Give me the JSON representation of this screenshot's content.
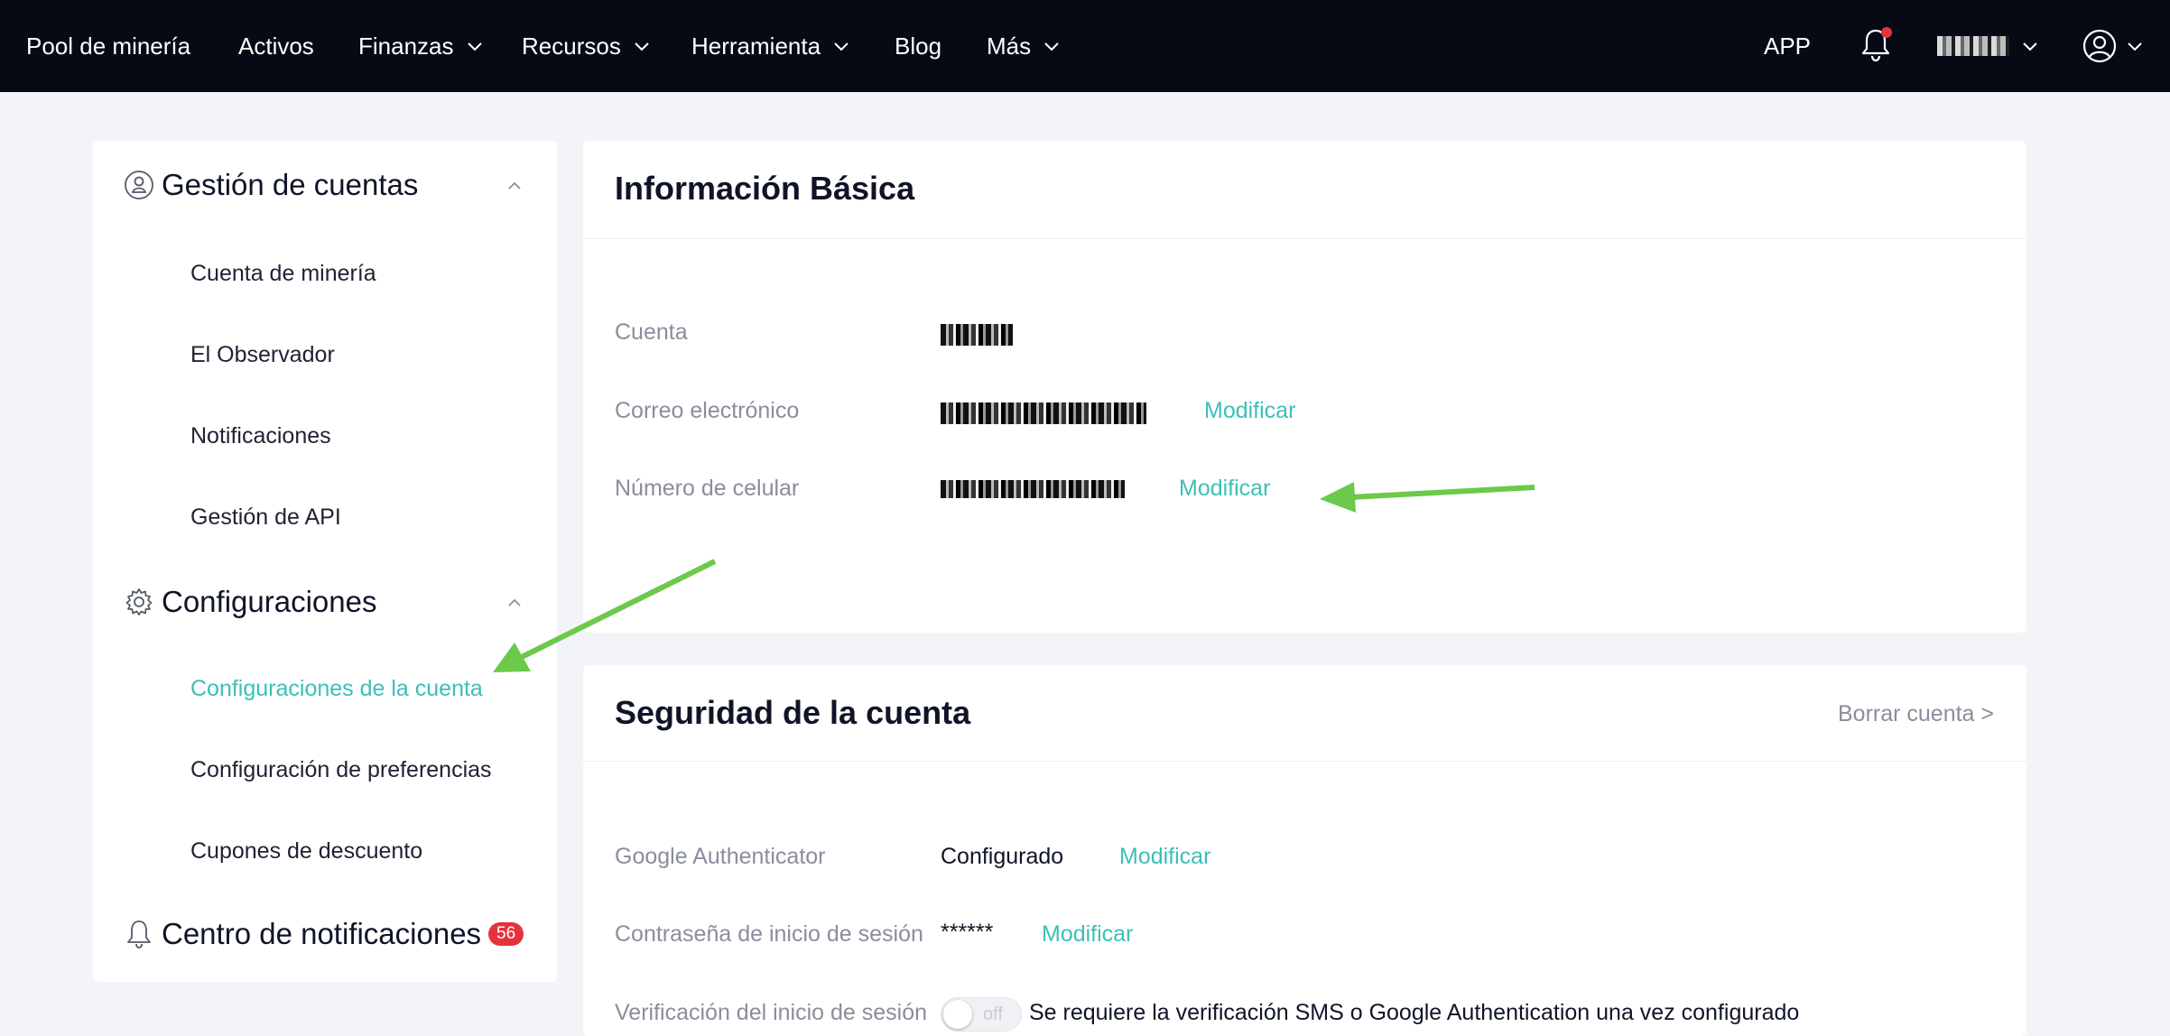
{
  "topnav": {
    "brand": "Pool de minería",
    "items": [
      {
        "label": "Activos"
      },
      {
        "label": "Finanzas"
      },
      {
        "label": "Recursos"
      },
      {
        "label": "Herramienta"
      },
      {
        "label": "Blog"
      },
      {
        "label": "Más"
      }
    ],
    "app_label": "APP",
    "notification_dot_color": "#e5323d"
  },
  "sidebar": {
    "account_group": {
      "title": "Gestión de cuentas",
      "items": [
        "Cuenta de minería",
        "El Observador",
        "Notificaciones",
        "Gestión de API"
      ]
    },
    "settings_group": {
      "title": "Configuraciones",
      "items": [
        "Configuraciones de la cuenta",
        "Configuración de preferencias",
        "Cupones de descuento"
      ],
      "active_index": 0
    },
    "notification_center": {
      "title": "Centro de notificaciones",
      "badge": "56"
    }
  },
  "basic_info": {
    "title": "Información Básica",
    "rows": [
      {
        "label": "Cuenta"
      },
      {
        "label": "Correo electrónico",
        "action": "Modificar"
      },
      {
        "label": "Número de celular",
        "action": "Modificar"
      }
    ]
  },
  "security": {
    "title": "Seguridad de la cuenta",
    "delete_link": "Borrar cuenta >",
    "rows": [
      {
        "label": "Google Authenticator",
        "value": "Configurado",
        "action": "Modificar"
      },
      {
        "label": "Contraseña de inicio de sesión",
        "value": "******",
        "action": "Modificar"
      },
      {
        "label": "Verificación del inicio de sesión",
        "toggle": "off",
        "note": "Se requiere la verificación SMS o Google Authentication una vez configurado"
      }
    ]
  },
  "colors": {
    "accent": "#3cbfb8",
    "topbar": "#050a14",
    "badge": "#e5323d",
    "annotation_arrow": "#6cc94a"
  }
}
